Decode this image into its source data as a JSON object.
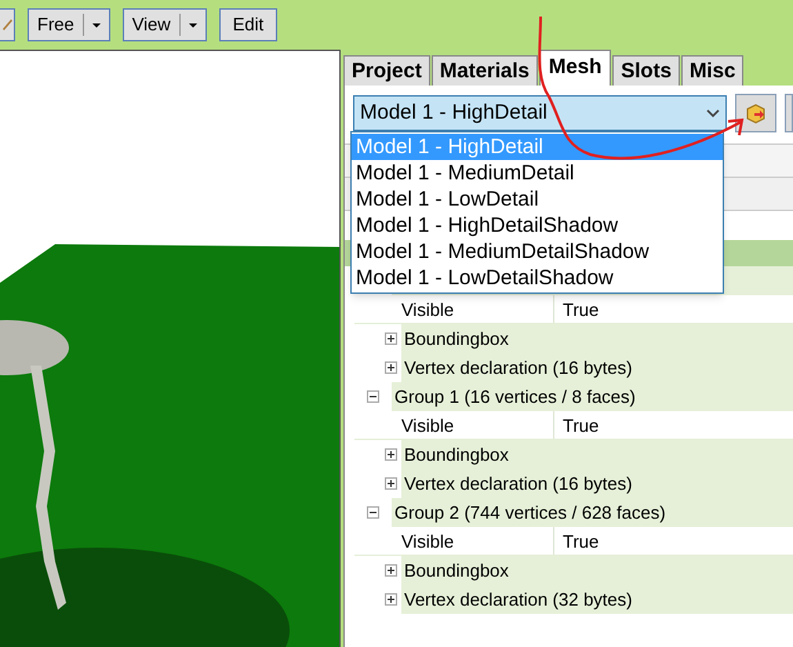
{
  "toolbar": {
    "buttons": [
      {
        "kind": "icon"
      },
      {
        "kind": "split",
        "label": "Free"
      },
      {
        "kind": "split",
        "label": "View"
      },
      {
        "kind": "plain",
        "label": "Edit"
      }
    ]
  },
  "tabs": [
    {
      "label": "Project",
      "selected": false
    },
    {
      "label": "Materials",
      "selected": false
    },
    {
      "label": "Mesh",
      "selected": true
    },
    {
      "label": "Slots",
      "selected": false
    },
    {
      "label": "Misc",
      "selected": false
    }
  ],
  "mesh_select": {
    "value": "Model 1 - HighDetail",
    "expanded": true,
    "options": [
      {
        "label": "Model 1 - HighDetail",
        "selected": true
      },
      {
        "label": "Model 1 - MediumDetail",
        "selected": false
      },
      {
        "label": "Model 1 - LowDetail",
        "selected": false
      },
      {
        "label": "Model 1 - HighDetailShadow",
        "selected": false
      },
      {
        "label": "Model 1 - MediumDetailShadow",
        "selected": false
      },
      {
        "label": "Model 1 - LowDetailShadow",
        "selected": false
      }
    ]
  },
  "tree": [
    {
      "children": [
        {
          "kind": "property",
          "name": "Visible",
          "value": "True"
        },
        {
          "kind": "node",
          "label": "Boundingbox",
          "expanded": false
        },
        {
          "kind": "node",
          "label": "Vertex declaration (16 bytes)",
          "expanded": false
        }
      ]
    },
    {
      "label": "Group 1 (16 vertices / 8 faces)",
      "expanded": true,
      "children": [
        {
          "kind": "property",
          "name": "Visible",
          "value": "True"
        },
        {
          "kind": "node",
          "label": "Boundingbox",
          "expanded": false
        },
        {
          "kind": "node",
          "label": "Vertex declaration (16 bytes)",
          "expanded": false
        }
      ]
    },
    {
      "label": "Group 2 (744 vertices / 628 faces)",
      "expanded": true,
      "children": [
        {
          "kind": "property",
          "name": "Visible",
          "value": "True"
        },
        {
          "kind": "node",
          "label": "Boundingbox",
          "expanded": false
        },
        {
          "kind": "node",
          "label": "Vertex declaration (32 bytes)",
          "expanded": false
        }
      ]
    }
  ]
}
